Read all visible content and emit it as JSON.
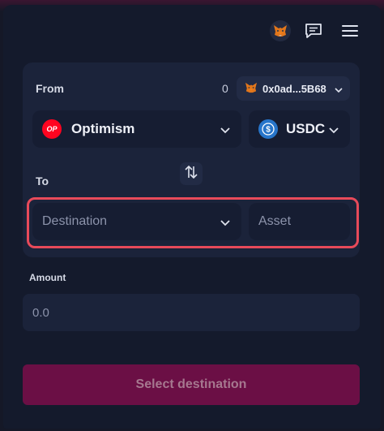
{
  "header": {
    "icons": [
      "metamask-fox-icon",
      "chat-icon",
      "menu-icon"
    ]
  },
  "from": {
    "label": "From",
    "count": "0",
    "wallet_address": "0x0ad...5B68",
    "chain": {
      "name": "Optimism",
      "badge_text": "OP",
      "color": "#ff0420"
    },
    "token": {
      "name": "USDC",
      "color": "#2775ca"
    }
  },
  "to": {
    "label": "To",
    "destination_placeholder": "Destination",
    "asset_placeholder": "Asset"
  },
  "amount": {
    "label": "Amount",
    "value": "0.0"
  },
  "cta": {
    "label": "Select destination"
  },
  "colors": {
    "highlight": "#e84a5a",
    "cta_bg": "#6b0f45"
  }
}
